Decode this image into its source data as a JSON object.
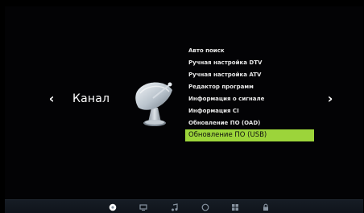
{
  "category": {
    "title": "Канал",
    "icon": "satellite-dish-icon",
    "prev_arrow": "‹",
    "next_arrow": "›"
  },
  "menu": {
    "items": [
      {
        "label": "Авто поиск"
      },
      {
        "label": "Ручная настройка DTV"
      },
      {
        "label": "Ручная настройка ATV"
      },
      {
        "label": "Редактор программ"
      },
      {
        "label": "Информация о сигнале"
      },
      {
        "label": "Информация CI"
      },
      {
        "label": "Обновление ПО (OAD)"
      },
      {
        "label": "Обновление  ПО (USB)"
      }
    ],
    "selected_label": "Обновление  ПО (USB)"
  },
  "bottom_bar": {
    "icons": [
      "channel-icon",
      "picture-icon",
      "sound-icon",
      "time-icon",
      "options-icon",
      "lock-icon"
    ],
    "active_icon": "channel-icon"
  },
  "colors": {
    "background": "#030305",
    "highlight": "#9cd43a",
    "text": "#e8e8e8",
    "bar": "#161c24"
  }
}
